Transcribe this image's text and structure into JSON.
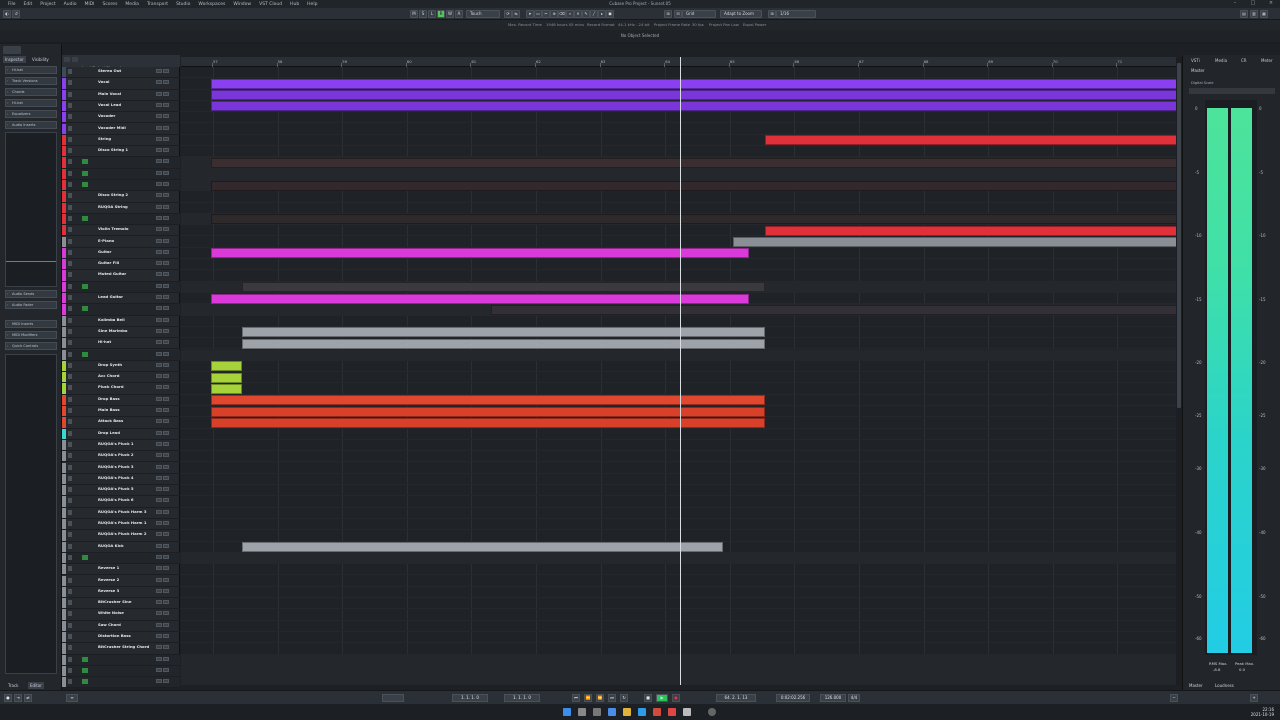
{
  "window": {
    "title": "Cubase Pro Project - Sunset.05",
    "menu": [
      "File",
      "Edit",
      "Project",
      "Audio",
      "MIDI",
      "Scores",
      "Media",
      "Transport",
      "Studio",
      "Workspaces",
      "Window",
      "VST Cloud",
      "Hub",
      "Help"
    ]
  },
  "toolbar": {
    "buttons": [
      "M",
      "S",
      "L",
      "R",
      "W",
      "A",
      "Touch"
    ],
    "snap": "Grid",
    "snap_type": "Adapt to Zoom",
    "quantize": "1/16"
  },
  "status": {
    "max_record": "Max. Record Time",
    "record_time": "1946 hours 05 mins",
    "record_format": "Record Format",
    "format_val": "44.1 kHz - 24 bit",
    "frame_rate": "Project Frame Rate",
    "frame_val": "30 fps",
    "pan_law": "Project Pan Law",
    "pan_val": "Equal Power"
  },
  "info_line": "No Object Selected",
  "left_zone": {
    "tabs": [
      "Inspector",
      "Visibility"
    ],
    "sections": [
      "Hi-hat",
      "Track Versions",
      "Chords",
      "Hi-hat",
      "Equalizers",
      "Audio Inserts"
    ],
    "sections_bottom": [
      "Audio Sends",
      "Audio Fader",
      "MIDI Inserts",
      "MIDI Modifiers",
      "Quick Controls"
    ],
    "bottom_tabs": [
      "Track",
      "Editor"
    ]
  },
  "tracklist_header": "Input/Output Channels",
  "tracks": [
    {
      "name": "Stereo Out",
      "color": "#3a4b59",
      "sub": false
    },
    {
      "name": "Vocal",
      "color": "#8a3ff0",
      "sub": false
    },
    {
      "name": "Main Vocal",
      "color": "#8a3ff0",
      "sub": false
    },
    {
      "name": "Vocal Lead",
      "color": "#8a3ff0",
      "sub": false
    },
    {
      "name": "Vocoder",
      "color": "#8a3ff0",
      "sub": false
    },
    {
      "name": "Vocoder Midi",
      "color": "#8a3ff0",
      "sub": false
    },
    {
      "name": "String",
      "color": "#e0303a",
      "sub": false
    },
    {
      "name": "Disco String 1",
      "color": "#e0303a",
      "sub": false
    },
    {
      "name": "",
      "color": "#e0303a",
      "sub": true
    },
    {
      "name": "",
      "color": "#e0303a",
      "sub": true
    },
    {
      "name": "",
      "color": "#e0303a",
      "sub": true
    },
    {
      "name": "Disco String 2",
      "color": "#e0303a",
      "sub": false
    },
    {
      "name": "RUQOA String",
      "color": "#e0303a",
      "sub": false
    },
    {
      "name": "",
      "color": "#e0303a",
      "sub": true
    },
    {
      "name": "Violin Tremolo",
      "color": "#e0303a",
      "sub": false
    },
    {
      "name": "E-Piano",
      "color": "#8a8f96",
      "sub": false
    },
    {
      "name": "Guitar",
      "color": "#d93ad9",
      "sub": false
    },
    {
      "name": "Guitar Fill",
      "color": "#d93ad9",
      "sub": false
    },
    {
      "name": "Muted Guitar",
      "color": "#d93ad9",
      "sub": false
    },
    {
      "name": "",
      "color": "#d93ad9",
      "sub": true
    },
    {
      "name": "Lead Guitar",
      "color": "#d93ad9",
      "sub": false
    },
    {
      "name": "",
      "color": "#d93ad9",
      "sub": true
    },
    {
      "name": "Kalimba Bell",
      "color": "#8a8f96",
      "sub": false
    },
    {
      "name": "Sine Marimba",
      "color": "#8a8f96",
      "sub": false
    },
    {
      "name": "Hi-hat",
      "color": "#8a8f96",
      "sub": false
    },
    {
      "name": "",
      "color": "#8a8f96",
      "sub": true
    },
    {
      "name": "Drop Synth",
      "color": "#a6d23a",
      "sub": false
    },
    {
      "name": "Acc Chord",
      "color": "#a6d23a",
      "sub": false
    },
    {
      "name": "Pluck Chord",
      "color": "#a6d23a",
      "sub": false
    },
    {
      "name": "Drop Bass",
      "color": "#e0472e",
      "sub": false
    },
    {
      "name": "Main Bass",
      "color": "#e0472e",
      "sub": false
    },
    {
      "name": "Attack Bass",
      "color": "#e0472e",
      "sub": false
    },
    {
      "name": "Drop Lead",
      "color": "#3ad8d0",
      "sub": false
    },
    {
      "name": "RUQOA's Pluck 1",
      "color": "#8a8f96",
      "sub": false
    },
    {
      "name": "RUQOA's Pluck 2",
      "color": "#8a8f96",
      "sub": false
    },
    {
      "name": "RUQOA's Pluck 3",
      "color": "#8a8f96",
      "sub": false
    },
    {
      "name": "RUQOA's Pluck 4",
      "color": "#8a8f96",
      "sub": false
    },
    {
      "name": "RUQOA's Pluck 5",
      "color": "#8a8f96",
      "sub": false
    },
    {
      "name": "RUQOA's Pluck 6",
      "color": "#8a8f96",
      "sub": false
    },
    {
      "name": "RUQOA's Pluck Harm 3",
      "color": "#8a8f96",
      "sub": false
    },
    {
      "name": "RUQOA's Pluck Harm 1",
      "color": "#8a8f96",
      "sub": false
    },
    {
      "name": "RUQOA's Pluck Harm 2",
      "color": "#8a8f96",
      "sub": false
    },
    {
      "name": "RUQOA Kick",
      "color": "#8a8f96",
      "sub": false
    },
    {
      "name": "",
      "color": "#8a8f96",
      "sub": true
    },
    {
      "name": "Reverse 1",
      "color": "#8a8f96",
      "sub": false
    },
    {
      "name": "Reverse 2",
      "color": "#8a8f96",
      "sub": false
    },
    {
      "name": "Reverse 3",
      "color": "#8a8f96",
      "sub": false
    },
    {
      "name": "BitCrusher Sine",
      "color": "#8a8f96",
      "sub": false
    },
    {
      "name": "White Noise",
      "color": "#8a8f96",
      "sub": false
    },
    {
      "name": "Saw Chord",
      "color": "#8a8f96",
      "sub": false
    },
    {
      "name": "Distortion Bass",
      "color": "#8a8f96",
      "sub": false
    },
    {
      "name": "BitCrusher String Chord",
      "color": "#8a8f96",
      "sub": false
    },
    {
      "name": "",
      "color": "#8a8f96",
      "sub": true
    },
    {
      "name": "",
      "color": "#8a8f96",
      "sub": true
    },
    {
      "name": "",
      "color": "#8a8f96",
      "sub": true
    }
  ],
  "ruler": [
    "57",
    "58",
    "59",
    "60",
    "61",
    "62",
    "63",
    "64",
    "65",
    "66",
    "67",
    "68",
    "69",
    "70",
    "71"
  ],
  "right_zone": {
    "tabs": [
      "VSTi",
      "Media",
      "CR",
      "Meter"
    ],
    "section": "Master",
    "subsection": "Digital Scale",
    "scale": [
      "0",
      "-5",
      "-10",
      "-15",
      "-20",
      "-25",
      "-30",
      "-40",
      "-50",
      "-60"
    ],
    "rms_label": "RMS Max.",
    "rms_val": "-8.8",
    "peak_label": "Peak Max.",
    "peak_val": "0.0",
    "bottom_tabs": [
      "Master",
      "Loudness"
    ]
  },
  "transport": {
    "left_locator": "1. 1. 1. 0",
    "right_locator": "1. 1. 1. 0",
    "position": "64. 2. 1. 13",
    "time": "0:02:02.256",
    "tempo": "126.000",
    "signature": "4/4"
  },
  "clock": {
    "time": "22:16",
    "date": "2021-10-19"
  }
}
